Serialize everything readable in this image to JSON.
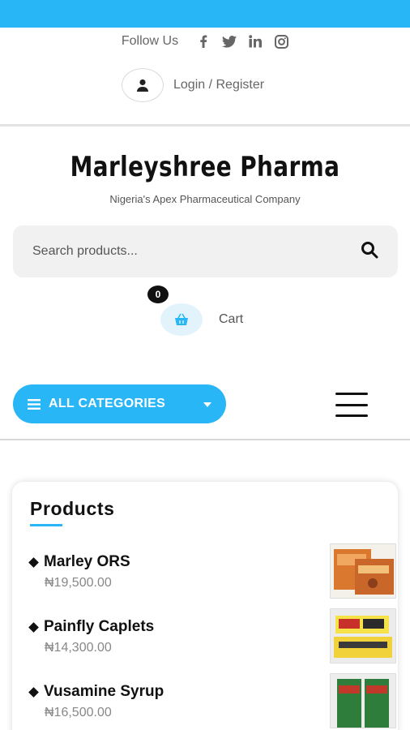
{
  "header": {
    "follow_label": "Follow Us",
    "social_icons": [
      "facebook-icon",
      "twitter-icon",
      "linkedin-icon",
      "instagram-icon"
    ],
    "login_label": "Login / Register"
  },
  "brand": {
    "name": "Marleyshree Pharma",
    "tagline": "Nigeria's Apex Pharmaceutical Company"
  },
  "search": {
    "placeholder": "Search products..."
  },
  "cart": {
    "count": "0",
    "label": "Cart"
  },
  "nav": {
    "categories_label": "ALL CATEGORIES"
  },
  "products_section": {
    "title": "Products",
    "items": [
      {
        "name": "Marley ORS",
        "price": "₦19,500.00"
      },
      {
        "name": "Painfly Caplets",
        "price": "₦14,300.00"
      },
      {
        "name": "Vusamine Syrup",
        "price": "₦16,500.00"
      }
    ]
  },
  "colors": {
    "accent": "#29b6f6",
    "text_dark": "#111111",
    "text_muted": "#666666"
  }
}
